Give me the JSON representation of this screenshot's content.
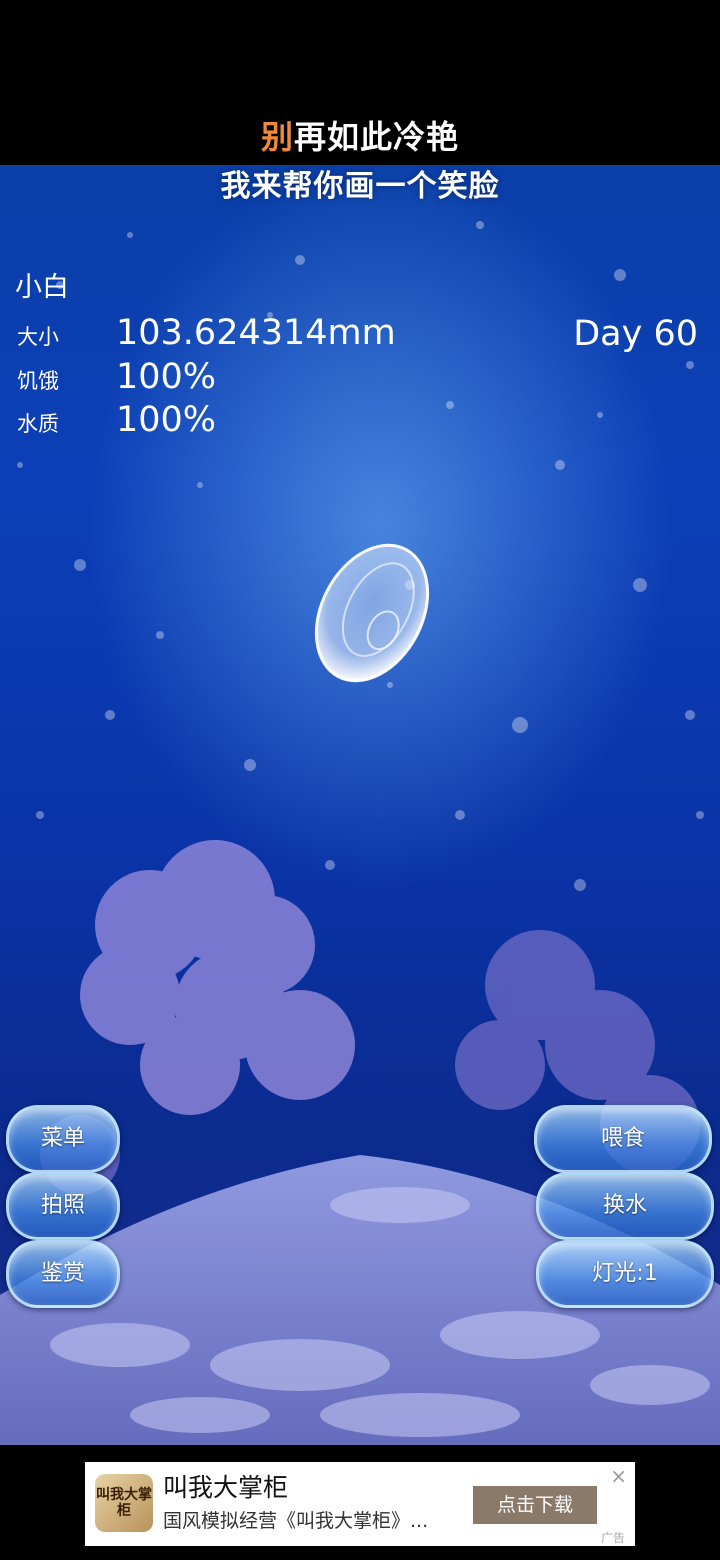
{
  "lyrics": {
    "line1_first_char": "别",
    "line1_rest": "再如此冷艳",
    "line1_accent_color": "#f08a3a",
    "line2": "我来帮你画一个笑脸"
  },
  "status": {
    "name": "小白",
    "size_label": "大小",
    "size_value": "103.624314mm",
    "hunger_label": "饥饿",
    "hunger_value": "100%",
    "water_label": "水质",
    "water_value": "100%",
    "day": "Day 60"
  },
  "left_buttons": {
    "menu": "菜单",
    "photo": "拍照",
    "gallery": "鉴赏"
  },
  "right_buttons": {
    "feed": "喂食",
    "change_water": "换水",
    "light": "灯光:1"
  },
  "ad": {
    "logo_text": "叫我大掌柜",
    "title": "叫我大掌柜",
    "description": "国风模拟经营《叫我大掌柜》...",
    "cta": "点击下载",
    "close_icon": "×",
    "tag": "广告"
  },
  "colors": {
    "water_top": "#0a3fa8",
    "water_bottom": "#1b2b86",
    "button_border": "#c8ebff"
  }
}
